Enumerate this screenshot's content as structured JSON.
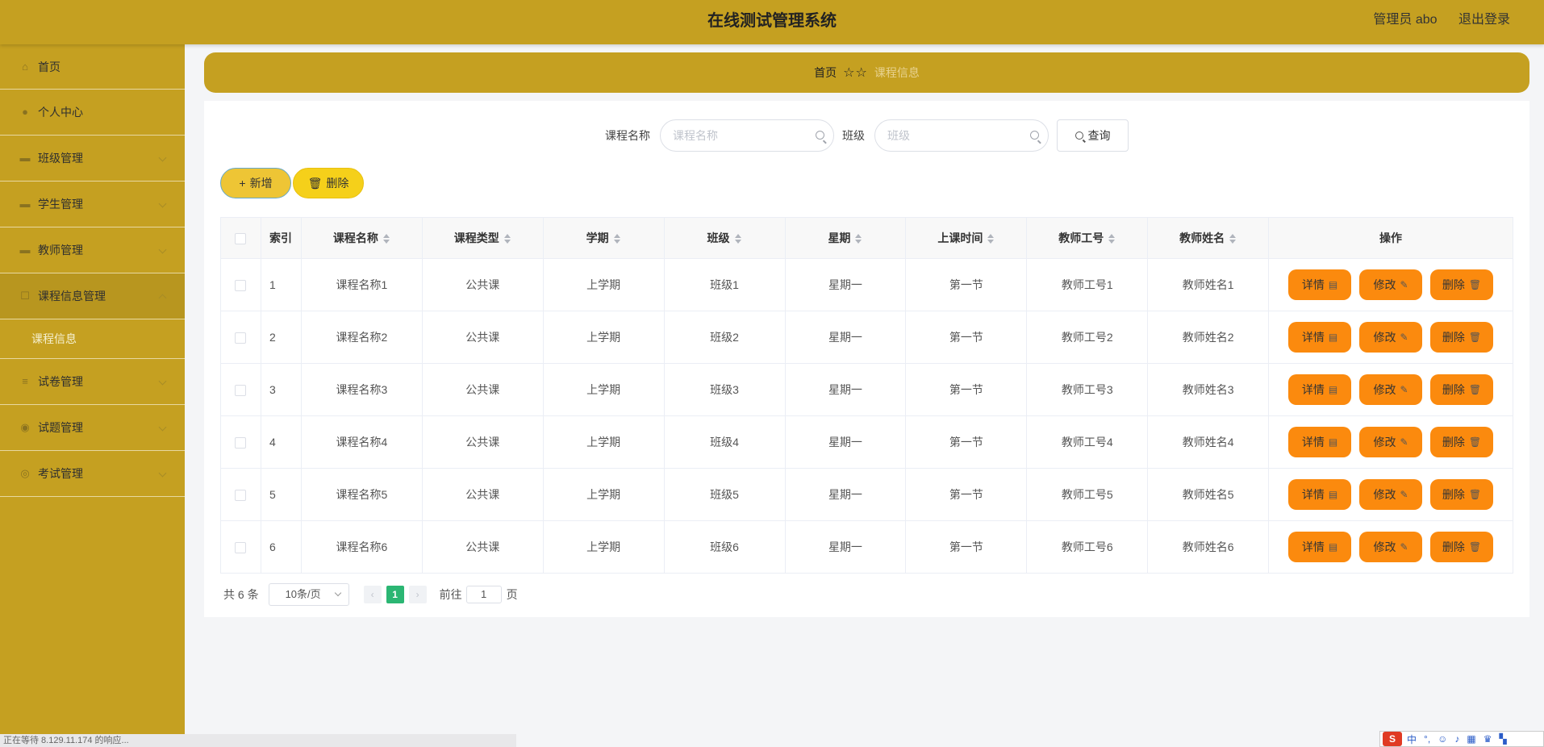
{
  "header": {
    "title": "在线测试管理系统",
    "user": "管理员 abo",
    "logout": "退出登录"
  },
  "sidebar": {
    "items": [
      {
        "label": "首页",
        "icon": "home-icon"
      },
      {
        "label": "个人中心",
        "icon": "user-icon"
      },
      {
        "label": "班级管理",
        "icon": "class-icon"
      },
      {
        "label": "学生管理",
        "icon": "student-icon"
      },
      {
        "label": "教师管理",
        "icon": "teacher-icon"
      },
      {
        "label": "课程信息管理",
        "icon": "course-icon"
      },
      {
        "label": "课程信息",
        "icon": ""
      },
      {
        "label": "试卷管理",
        "icon": "paper-icon"
      },
      {
        "label": "试题管理",
        "icon": "question-icon"
      },
      {
        "label": "考试管理",
        "icon": "exam-icon"
      }
    ]
  },
  "breadcrumb": {
    "home": "首页",
    "current": "课程信息"
  },
  "search": {
    "course_label": "课程名称",
    "course_placeholder": "课程名称",
    "class_label": "班级",
    "class_placeholder": "班级",
    "query_button": "查询"
  },
  "actions": {
    "add": "新增",
    "delete": "删除"
  },
  "table": {
    "columns": [
      "索引",
      "课程名称",
      "课程类型",
      "学期",
      "班级",
      "星期",
      "上课时间",
      "教师工号",
      "教师姓名",
      "操作"
    ],
    "rows": [
      {
        "idx": "1",
        "name": "课程名称1",
        "type": "公共课",
        "term": "上学期",
        "cls": "班级1",
        "week": "星期一",
        "time": "第一节",
        "tid": "教师工号1",
        "tname": "教师姓名1"
      },
      {
        "idx": "2",
        "name": "课程名称2",
        "type": "公共课",
        "term": "上学期",
        "cls": "班级2",
        "week": "星期一",
        "time": "第一节",
        "tid": "教师工号2",
        "tname": "教师姓名2"
      },
      {
        "idx": "3",
        "name": "课程名称3",
        "type": "公共课",
        "term": "上学期",
        "cls": "班级3",
        "week": "星期一",
        "time": "第一节",
        "tid": "教师工号3",
        "tname": "教师姓名3"
      },
      {
        "idx": "4",
        "name": "课程名称4",
        "type": "公共课",
        "term": "上学期",
        "cls": "班级4",
        "week": "星期一",
        "time": "第一节",
        "tid": "教师工号4",
        "tname": "教师姓名4"
      },
      {
        "idx": "5",
        "name": "课程名称5",
        "type": "公共课",
        "term": "上学期",
        "cls": "班级5",
        "week": "星期一",
        "time": "第一节",
        "tid": "教师工号5",
        "tname": "教师姓名5"
      },
      {
        "idx": "6",
        "name": "课程名称6",
        "type": "公共课",
        "term": "上学期",
        "cls": "班级6",
        "week": "星期一",
        "time": "第一节",
        "tid": "教师工号6",
        "tname": "教师姓名6"
      }
    ],
    "op_detail": "详情",
    "op_edit": "修改",
    "op_delete": "删除"
  },
  "pager": {
    "total": "共 6 条",
    "page_size": "10条/页",
    "current_page": "1",
    "goto_label": "前往",
    "goto_value": "1",
    "page_unit": "页"
  },
  "status_bar": "正在等待 8.129.11.174 的响应...",
  "ime": {
    "logo": "S",
    "lang": "中"
  },
  "colors": {
    "header_bg": "#c5a021",
    "sidebar_bg": "#c5a021",
    "op_button": "#fb8a0e",
    "add_button": "#eec535",
    "delete_button": "#f5d01a",
    "active_page": "#2bb673"
  }
}
